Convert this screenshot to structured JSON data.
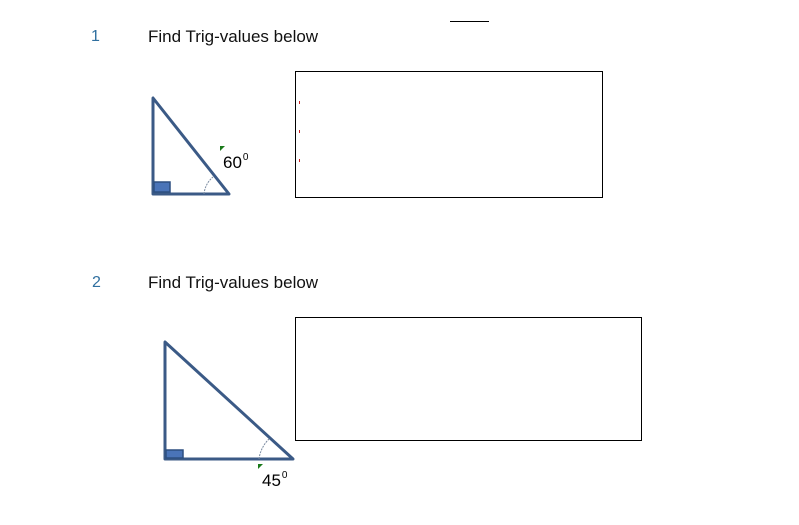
{
  "questions": [
    {
      "number": "1",
      "prompt": "Find Trig-values below",
      "angle_value": "60",
      "angle_unit": "0"
    },
    {
      "number": "2",
      "prompt": "Find Trig-values below",
      "angle_value": "45",
      "angle_unit": "0"
    }
  ],
  "colors": {
    "triangle_stroke": "#3b5a86",
    "right_angle_fill": "#4a74b8",
    "number_color": "#2f6f9f",
    "mark_green": "#1a7a1a",
    "mark_red": "#cc2020"
  }
}
